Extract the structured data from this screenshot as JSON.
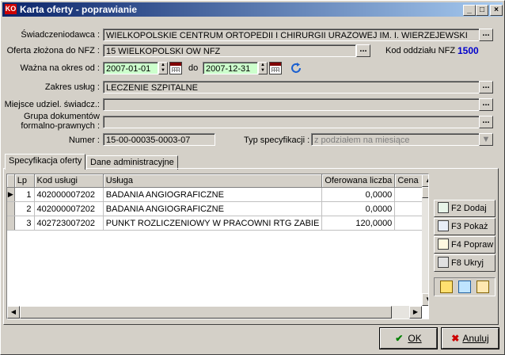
{
  "window": {
    "title": "Karta oferty - poprawianie",
    "icon_text": "KO"
  },
  "form": {
    "swiadczeniodawca_label": "Świadczeniodawca :",
    "swiadczeniodawca_value": "WIELKOPOLSKIE CENTRUM ORTOPEDII I CHIRURGII URAZOWEJ IM. I. WIERZEJEWSKI",
    "oferta_label": "Oferta złożona do NFZ :",
    "oferta_value": "15 WIELKOPOLSKI OW NFZ",
    "kod_oddzialu_label": "Kod oddziału NFZ",
    "kod_oddzialu_value": "1500",
    "wazna_label": "Ważna na okres od :",
    "date_from": "2007-01-01",
    "do_label": "do",
    "date_to": "2007-12-31",
    "zakres_label": "Zakres usług :",
    "zakres_value": "LECZENIE SZPITALNE",
    "miejsce_label": "Miejsce udziel. świadcz.:",
    "miejsce_value": "",
    "grupa_label_1": "Grupa dokumentów",
    "grupa_label_2": "formalno-prawnych :",
    "grupa_value": "",
    "numer_label": "Numer :",
    "numer_value": "15-00-00035-0003-07",
    "typ_label": "Typ specyfikacji :",
    "typ_value": "z podziałem na miesiące",
    "dots": "..."
  },
  "tabs": [
    {
      "label": "Specyfikacja oferty"
    },
    {
      "label": "Dane administracyjne"
    }
  ],
  "table": {
    "headers": [
      "Lp",
      "Kod usługi",
      "Usługa",
      "Oferowana liczba",
      "Cena"
    ],
    "rows": [
      {
        "lp": "1",
        "kod": "402000007202",
        "usluga": "BADANIA ANGIOGRAFICZNE",
        "liczba": "0,0000"
      },
      {
        "lp": "2",
        "kod": "402000007202",
        "usluga": "BADANIA ANGIOGRAFICZNE",
        "liczba": "0,0000"
      },
      {
        "lp": "3",
        "kod": "402723007202",
        "usluga": "PUNKT ROZLICZENIOWY W PRACOWNI RTG ZABIE",
        "liczba": "120,0000"
      }
    ]
  },
  "side_buttons": {
    "dodaj": "F2 Dodaj",
    "pokaz": "F3 Pokaż",
    "popraw": "F4 Popraw",
    "ukryj": "F8 Ukryj"
  },
  "footer": {
    "ok": "OK",
    "anuluj": "Anuluj"
  },
  "colors": {
    "accent_number": "#0000cc",
    "date_bg": "#ccffcc",
    "title_start": "#0a246a",
    "title_end": "#a6caf0"
  }
}
